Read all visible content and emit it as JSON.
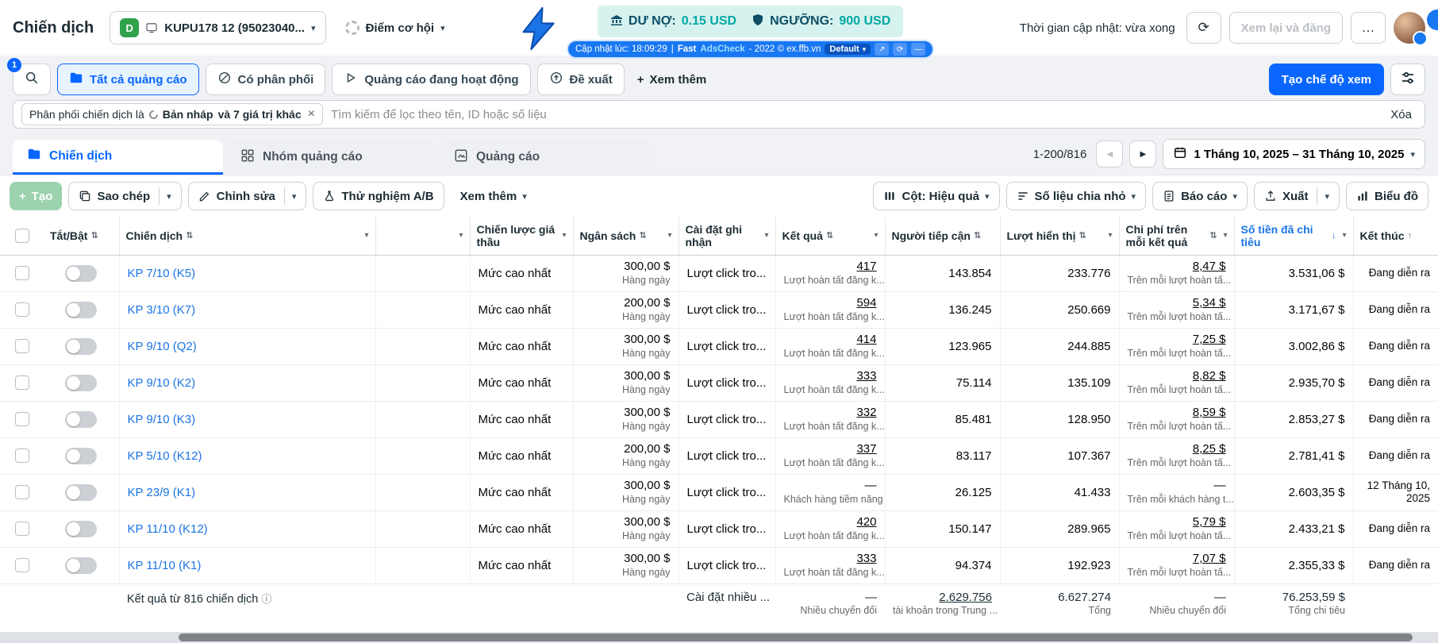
{
  "icons": {
    "caret_down": "▾",
    "sort": "⇅",
    "sort_desc": "↓",
    "sort_asc": "↑",
    "prev": "◀",
    "next": "▶",
    "refresh": "⟳",
    "more_h": "…",
    "plus": "+",
    "close": "×",
    "info": "ⓘ",
    "expand": "↗",
    "minimize": "—"
  },
  "header": {
    "page_title": "Chiến dịch",
    "account": {
      "badge": "D",
      "name": "KUPU178 12 (95023040..."
    },
    "opportunity": {
      "label": "Điểm cơ hội"
    },
    "debt_bar": {
      "du_no_label": "DƯ NỢ:",
      "du_no_value": "0.15 USD",
      "nguong_label": "NGƯỠNG:",
      "nguong_value": "900 USD"
    },
    "ext_bar": {
      "updated": "Cập nhật lúc: 18:09:29",
      "sep": "|",
      "brand_bold": "Fast",
      "brand_accent": "AdsCheck",
      "suffix": "- 2022 © ex.ffb.vn",
      "preset": "Default"
    },
    "update_time": "Thời gian cập nhật: vừa xong",
    "review_publish": "Xem lại và đăng"
  },
  "filter_tabs": {
    "search_badge": "1",
    "all_ads": "Tất cả quảng cáo",
    "had_delivery": "Có phân phối",
    "active_ads": "Quảng cáo đang hoạt động",
    "recommendations": "Đề xuất",
    "see_more": "Xem thêm",
    "create_view": "Tạo chế độ xem"
  },
  "filter_bar": {
    "chip_prefix": "Phân phối chiến dịch là",
    "chip_value": "Bản nháp",
    "chip_suffix": "và 7 giá trị khác",
    "search_placeholder": "Tìm kiếm để lọc theo tên, ID hoặc số liệu",
    "clear": "Xóa"
  },
  "tabs": {
    "campaigns": "Chiến dịch",
    "adsets": "Nhóm quảng cáo",
    "ads": "Quảng cáo"
  },
  "pagination": {
    "range": "1-200/816"
  },
  "date_range": {
    "label": "1 Tháng 10, 2025 – 31 Tháng 10, 2025"
  },
  "toolbar": {
    "create": "Tạo",
    "duplicate": "Sao chép",
    "edit": "Chỉnh sửa",
    "ab_test": "Thử nghiệm A/B",
    "see_more": "Xem thêm",
    "columns": "Cột: Hiệu quả",
    "breakdown": "Số liệu chia nhỏ",
    "report": "Báo cáo",
    "export": "Xuất",
    "charts": "Biểu đồ"
  },
  "table": {
    "headers": {
      "toggle": "Tắt/Bật",
      "campaign": "Chiến dịch",
      "bid_strategy": "Chiến lược giá thầu",
      "budget": "Ngân sách",
      "attribution": "Cài đặt ghi nhận",
      "results": "Kết quả",
      "reach": "Người tiếp cận",
      "impressions": "Lượt hiển thị",
      "cost_per_result": "Chi phí trên mỗi kết quả",
      "amount_spent": "Số tiền đã chi tiêu",
      "ends": "Kết thúc"
    },
    "rows": [
      {
        "name": "KP 7/10 (K5)",
        "bid_strategy": "Mức cao nhất",
        "budget": "300,00 $",
        "budget_sub": "Hàng ngày",
        "attribution": "Lượt click tro...",
        "results": "417",
        "results_sub": "Lượt hoàn tất đăng k...",
        "reach": "143.854",
        "impressions": "233.776",
        "cost_per_result": "8,47 $",
        "cost_per_result_sub": "Trên mỗi lượt hoàn tấ...",
        "amount_spent": "3.531,06 $",
        "ends": "Đang diễn ra"
      },
      {
        "name": "KP 3/10 (K7)",
        "bid_strategy": "Mức cao nhất",
        "budget": "200,00 $",
        "budget_sub": "Hàng ngày",
        "attribution": "Lượt click tro...",
        "results": "594",
        "results_sub": "Lượt hoàn tất đăng k...",
        "reach": "136.245",
        "impressions": "250.669",
        "cost_per_result": "5,34 $",
        "cost_per_result_sub": "Trên mỗi lượt hoàn tấ...",
        "amount_spent": "3.171,67 $",
        "ends": "Đang diễn ra"
      },
      {
        "name": "KP 9/10 (Q2)",
        "bid_strategy": "Mức cao nhất",
        "budget": "300,00 $",
        "budget_sub": "Hàng ngày",
        "attribution": "Lượt click tro...",
        "results": "414",
        "results_sub": "Lượt hoàn tất đăng k...",
        "reach": "123.965",
        "impressions": "244.885",
        "cost_per_result": "7,25 $",
        "cost_per_result_sub": "Trên mỗi lượt hoàn tấ...",
        "amount_spent": "3.002,86 $",
        "ends": "Đang diễn ra"
      },
      {
        "name": "KP 9/10 (K2)",
        "bid_strategy": "Mức cao nhất",
        "budget": "300,00 $",
        "budget_sub": "Hàng ngày",
        "attribution": "Lượt click tro...",
        "results": "333",
        "results_sub": "Lượt hoàn tất đăng k...",
        "reach": "75.114",
        "impressions": "135.109",
        "cost_per_result": "8,82 $",
        "cost_per_result_sub": "Trên mỗi lượt hoàn tấ...",
        "amount_spent": "2.935,70 $",
        "ends": "Đang diễn ra"
      },
      {
        "name": "KP 9/10 (K3)",
        "bid_strategy": "Mức cao nhất",
        "budget": "300,00 $",
        "budget_sub": "Hàng ngày",
        "attribution": "Lượt click tro...",
        "results": "332",
        "results_sub": "Lượt hoàn tất đăng k...",
        "reach": "85.481",
        "impressions": "128.950",
        "cost_per_result": "8,59 $",
        "cost_per_result_sub": "Trên mỗi lượt hoàn tấ...",
        "amount_spent": "2.853,27 $",
        "ends": "Đang diễn ra"
      },
      {
        "name": "KP 5/10 (K12)",
        "bid_strategy": "Mức cao nhất",
        "budget": "200,00 $",
        "budget_sub": "Hàng ngày",
        "attribution": "Lượt click tro...",
        "results": "337",
        "results_sub": "Lượt hoàn tất đăng k...",
        "reach": "83.117",
        "impressions": "107.367",
        "cost_per_result": "8,25 $",
        "cost_per_result_sub": "Trên mỗi lượt hoàn tấ...",
        "amount_spent": "2.781,41 $",
        "ends": "Đang diễn ra"
      },
      {
        "name": "KP 23/9 (K1)",
        "bid_strategy": "Mức cao nhất",
        "budget": "300,00 $",
        "budget_sub": "Hàng ngày",
        "attribution": "Lượt click tro...",
        "results": "—",
        "results_sub": "Khách hàng tiềm năng",
        "reach": "26.125",
        "impressions": "41.433",
        "cost_per_result": "—",
        "cost_per_result_sub": "Trên mỗi khách hàng t...",
        "amount_spent": "2.603,35 $",
        "ends": "12 Tháng 10, 2025"
      },
      {
        "name": "KP 11/10 (K12)",
        "bid_strategy": "Mức cao nhất",
        "budget": "300,00 $",
        "budget_sub": "Hàng ngày",
        "attribution": "Lượt click tro...",
        "results": "420",
        "results_sub": "Lượt hoàn tất đăng k...",
        "reach": "150.147",
        "impressions": "289.965",
        "cost_per_result": "5,79 $",
        "cost_per_result_sub": "Trên mỗi lượt hoàn tấ...",
        "amount_spent": "2.433,21 $",
        "ends": "Đang diễn ra"
      },
      {
        "name": "KP 11/10 (K1)",
        "bid_strategy": "Mức cao nhất",
        "budget": "300,00 $",
        "budget_sub": "Hàng ngày",
        "attribution": "Lượt click tro...",
        "results": "333",
        "results_sub": "Lượt hoàn tất đăng k...",
        "reach": "94.374",
        "impressions": "192.923",
        "cost_per_result": "7,07 $",
        "cost_per_result_sub": "Trên mỗi lượt hoàn tấ...",
        "amount_spent": "2.355,33 $",
        "ends": "Đang diễn ra"
      }
    ],
    "footer": {
      "summary": "Kết quả từ 816 chiến dịch",
      "attribution": "Cài đặt nhiều ...",
      "results": "—",
      "results_sub": "Nhiều chuyển đổi",
      "reach": "2.629.756",
      "reach_sub": "tài khoản trong Trung ...",
      "impressions": "6.627.274",
      "impressions_sub": "Tổng",
      "cost_per_result": "—",
      "cost_per_result_sub": "Nhiều chuyển đổi",
      "amount_spent": "76.253,59 $",
      "amount_spent_sub": "Tổng chi tiêu"
    }
  }
}
